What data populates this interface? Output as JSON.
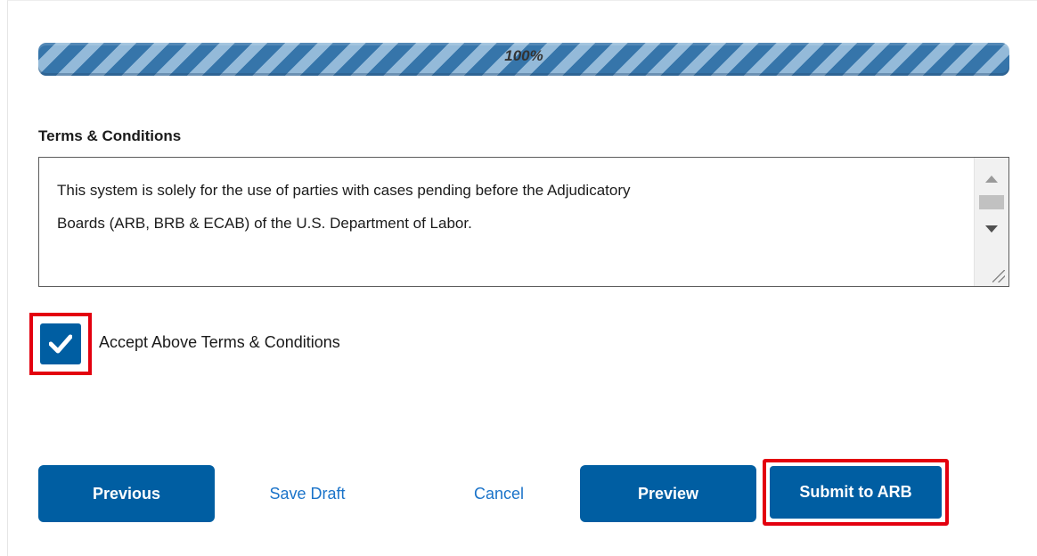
{
  "progress": {
    "value": 1.0,
    "label": "100%"
  },
  "terms": {
    "heading": "Terms & Conditions",
    "text_line1": "This system is solely for the use of parties with cases pending before the Adjudicatory",
    "text_line2": "Boards (ARB, BRB & ECAB) of the U.S. Department of Labor."
  },
  "accept": {
    "checked": true,
    "label": "Accept Above Terms & Conditions"
  },
  "buttons": {
    "previous": "Previous",
    "save_draft": "Save Draft",
    "cancel": "Cancel",
    "preview": "Preview",
    "submit": "Submit to ARB"
  },
  "colors": {
    "primary": "#005ea2",
    "link": "#1a73c9",
    "highlight": "#e3000f",
    "progress_stripe_dark": "#2c6ea6",
    "progress_stripe_light": "#8fb7d7"
  },
  "icons": {
    "checkbox": "checkmark-icon",
    "scroll_up": "arrow-up-icon",
    "scroll_down": "arrow-down-icon",
    "resize": "resize-grip-icon"
  }
}
